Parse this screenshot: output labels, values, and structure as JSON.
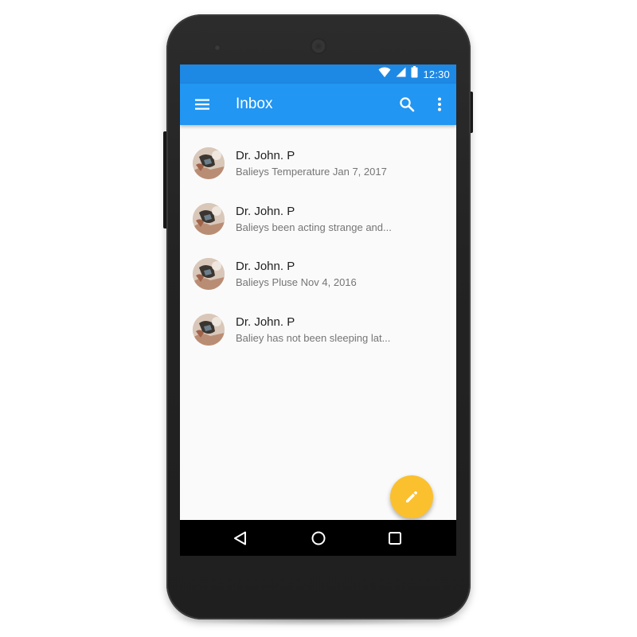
{
  "status_bar": {
    "time": "12:30",
    "icons": [
      "wifi-icon",
      "cell-signal-icon",
      "battery-icon"
    ]
  },
  "toolbar": {
    "title": "Inbox",
    "icons": [
      "menu-icon",
      "search-icon",
      "more-vert-icon"
    ]
  },
  "messages": [
    {
      "sender": "Dr. John. P",
      "preview": "Balieys Temperature Jan 7, 2017"
    },
    {
      "sender": "Dr. John. P",
      "preview": "Balieys been acting strange and..."
    },
    {
      "sender": "Dr. John. P",
      "preview": "Balieys Pluse Nov 4, 2016"
    },
    {
      "sender": "Dr. John. P",
      "preview": "Baliey has not been sleeping lat..."
    }
  ],
  "fab": {
    "icon": "pencil-icon",
    "color": "#fbc02d"
  },
  "navigation": {
    "icons": [
      "back-icon",
      "home-icon",
      "recents-icon"
    ]
  },
  "colors": {
    "status_bar": "#1e88e5",
    "toolbar": "#2196f3",
    "list_background": "#fafafa"
  }
}
